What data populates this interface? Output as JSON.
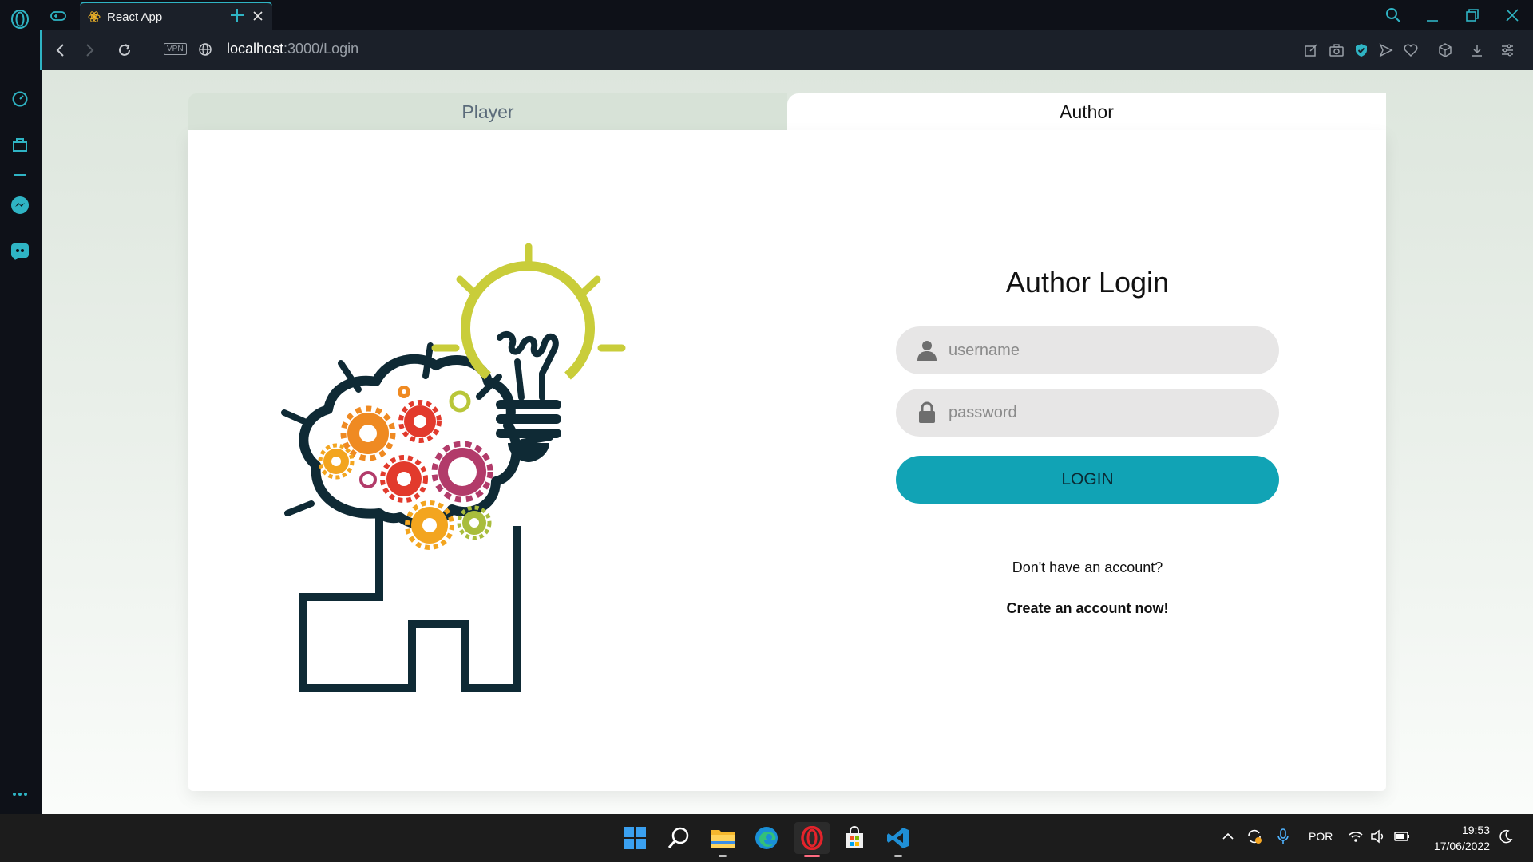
{
  "browser": {
    "tab_title": "React App",
    "vpn_badge": "VPN",
    "url_host": "localhost",
    "url_path": ":3000/Login"
  },
  "page": {
    "tabs": [
      {
        "label": "Player",
        "active": false
      },
      {
        "label": "Author",
        "active": true
      }
    ],
    "login": {
      "title": "Author Login",
      "username_placeholder": "username",
      "password_placeholder": "password",
      "button_label": "LOGIN",
      "divider": "________________________",
      "no_account_text": "Don't have an account?",
      "create_link": "Create an account now!"
    },
    "illustration": "brain-gears-lightbulb"
  },
  "taskbar": {
    "apps": [
      "windows-start",
      "search",
      "file-explorer",
      "edge",
      "opera",
      "microsoft-store",
      "vscode"
    ],
    "language": "POR",
    "time": "19:53",
    "date": "17/06/2022"
  },
  "colors": {
    "accent": "#2fb4c4",
    "login_button": "#11a3b5",
    "field_bg": "#e7e6e6",
    "player_tab_bg": "#d7e2d7"
  }
}
